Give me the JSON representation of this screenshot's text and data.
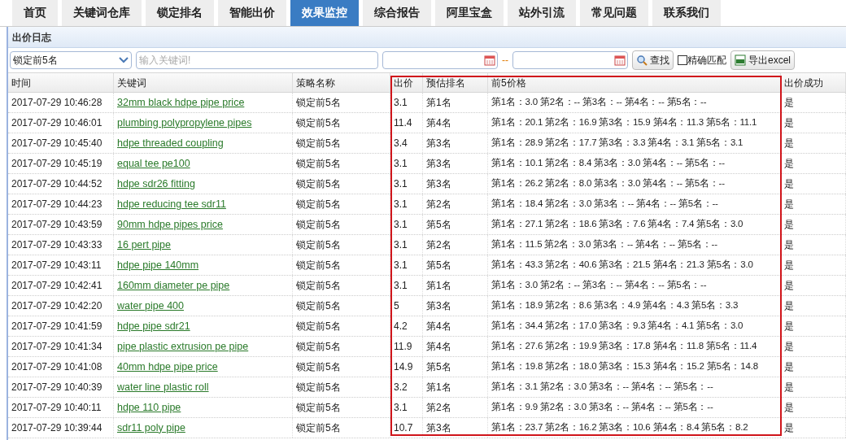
{
  "nav_tabs": [
    {
      "label": "首页",
      "selected": false
    },
    {
      "label": "关键词仓库",
      "selected": false
    },
    {
      "label": "锁定排名",
      "selected": false
    },
    {
      "label": "智能出价",
      "selected": false
    },
    {
      "label": "效果监控",
      "selected": true
    },
    {
      "label": "综合报告",
      "selected": false
    },
    {
      "label": "阿里宝盒",
      "selected": false
    },
    {
      "label": "站外引流",
      "selected": false
    },
    {
      "label": "常见问题",
      "selected": false
    },
    {
      "label": "联系我们",
      "selected": false
    }
  ],
  "panel": {
    "title": "出价日志"
  },
  "toolbar": {
    "strategy_select": "锁定前5名",
    "keyword_input": {
      "placeholder": "输入关键词!"
    },
    "date_separator": "--",
    "search_button": "查找",
    "exact_match": {
      "label": "精确匹配",
      "checked": false
    },
    "export_button": "导出excel"
  },
  "table": {
    "columns": [
      "时间",
      "关键词",
      "策略名称",
      "出价",
      "预估排名",
      "前5价格",
      "出价成功"
    ],
    "rows": [
      [
        "2017-07-29 10:46:28",
        "32mm black hdpe pipe price",
        "锁定前5名",
        "3.1",
        "第1名",
        "第1名：3.0 第2名：-- 第3名：-- 第4名：-- 第5名：--",
        "是"
      ],
      [
        "2017-07-29 10:46:01",
        "plumbing polypropylene pipes",
        "锁定前5名",
        "11.4",
        "第4名",
        "第1名：20.1 第2名：16.9 第3名：15.9 第4名：11.3 第5名：11.1",
        "是"
      ],
      [
        "2017-07-29 10:45:40",
        "hdpe threaded coupling",
        "锁定前5名",
        "3.4",
        "第3名",
        "第1名：28.9 第2名：17.7 第3名：3.3 第4名：3.1 第5名：3.1",
        "是"
      ],
      [
        "2017-07-29 10:45:19",
        "equal tee pe100",
        "锁定前5名",
        "3.1",
        "第3名",
        "第1名：10.1 第2名：8.4 第3名：3.0 第4名：-- 第5名：--",
        "是"
      ],
      [
        "2017-07-29 10:44:52",
        "hdpe sdr26 fitting",
        "锁定前5名",
        "3.1",
        "第3名",
        "第1名：26.2 第2名：8.0 第3名：3.0 第4名：-- 第5名：--",
        "是"
      ],
      [
        "2017-07-29 10:44:23",
        "hdpe reducing tee sdr11",
        "锁定前5名",
        "3.1",
        "第2名",
        "第1名：18.4 第2名：3.0 第3名：-- 第4名：-- 第5名：--",
        "是"
      ],
      [
        "2017-07-29 10:43:59",
        "90mm hdpe pipes price",
        "锁定前5名",
        "3.1",
        "第5名",
        "第1名：27.1 第2名：18.6 第3名：7.6 第4名：7.4 第5名：3.0",
        "是"
      ],
      [
        "2017-07-29 10:43:33",
        "16 pert pipe",
        "锁定前5名",
        "3.1",
        "第2名",
        "第1名：11.5 第2名：3.0 第3名：-- 第4名：-- 第5名：--",
        "是"
      ],
      [
        "2017-07-29 10:43:11",
        "hdpe pipe 140mm",
        "锁定前5名",
        "3.1",
        "第5名",
        "第1名：43.3 第2名：40.6 第3名：21.5 第4名：21.3 第5名：3.0",
        "是"
      ],
      [
        "2017-07-29 10:42:41",
        "160mm diameter pe pipe",
        "锁定前5名",
        "3.1",
        "第1名",
        "第1名：3.0 第2名：-- 第3名：-- 第4名：-- 第5名：--",
        "是"
      ],
      [
        "2017-07-29 10:42:20",
        "water pipe 400",
        "锁定前5名",
        "5",
        "第3名",
        "第1名：18.9 第2名：8.6 第3名：4.9 第4名：4.3 第5名：3.3",
        "是"
      ],
      [
        "2017-07-29 10:41:59",
        "hdpe pipe sdr21",
        "锁定前5名",
        "4.2",
        "第4名",
        "第1名：34.4 第2名：17.0 第3名：9.3 第4名：4.1 第5名：3.0",
        "是"
      ],
      [
        "2017-07-29 10:41:34",
        "pipe plastic extrusion pe pipe",
        "锁定前5名",
        "11.9",
        "第4名",
        "第1名：27.6 第2名：19.9 第3名：17.8 第4名：11.8 第5名：11.4",
        "是"
      ],
      [
        "2017-07-29 10:41:08",
        "40mm hdpe pipe price",
        "锁定前5名",
        "14.9",
        "第5名",
        "第1名：19.8 第2名：18.0 第3名：15.3 第4名：15.2 第5名：14.8",
        "是"
      ],
      [
        "2017-07-29 10:40:39",
        "water line plastic roll",
        "锁定前5名",
        "3.2",
        "第1名",
        "第1名：3.1 第2名：3.0 第3名：-- 第4名：-- 第5名：--",
        "是"
      ],
      [
        "2017-07-29 10:40:11",
        "hdpe 110 pipe",
        "锁定前5名",
        "3.1",
        "第2名",
        "第1名：9.9 第2名：3.0 第3名：-- 第4名：-- 第5名：--",
        "是"
      ],
      [
        "2017-07-29 10:39:44",
        "sdr11 poly pipe",
        "锁定前5名",
        "10.7",
        "第3名",
        "第1名：23.7 第2名：16.2 第3名：10.6 第4名：8.4 第5名：8.2",
        "是"
      ]
    ]
  }
}
